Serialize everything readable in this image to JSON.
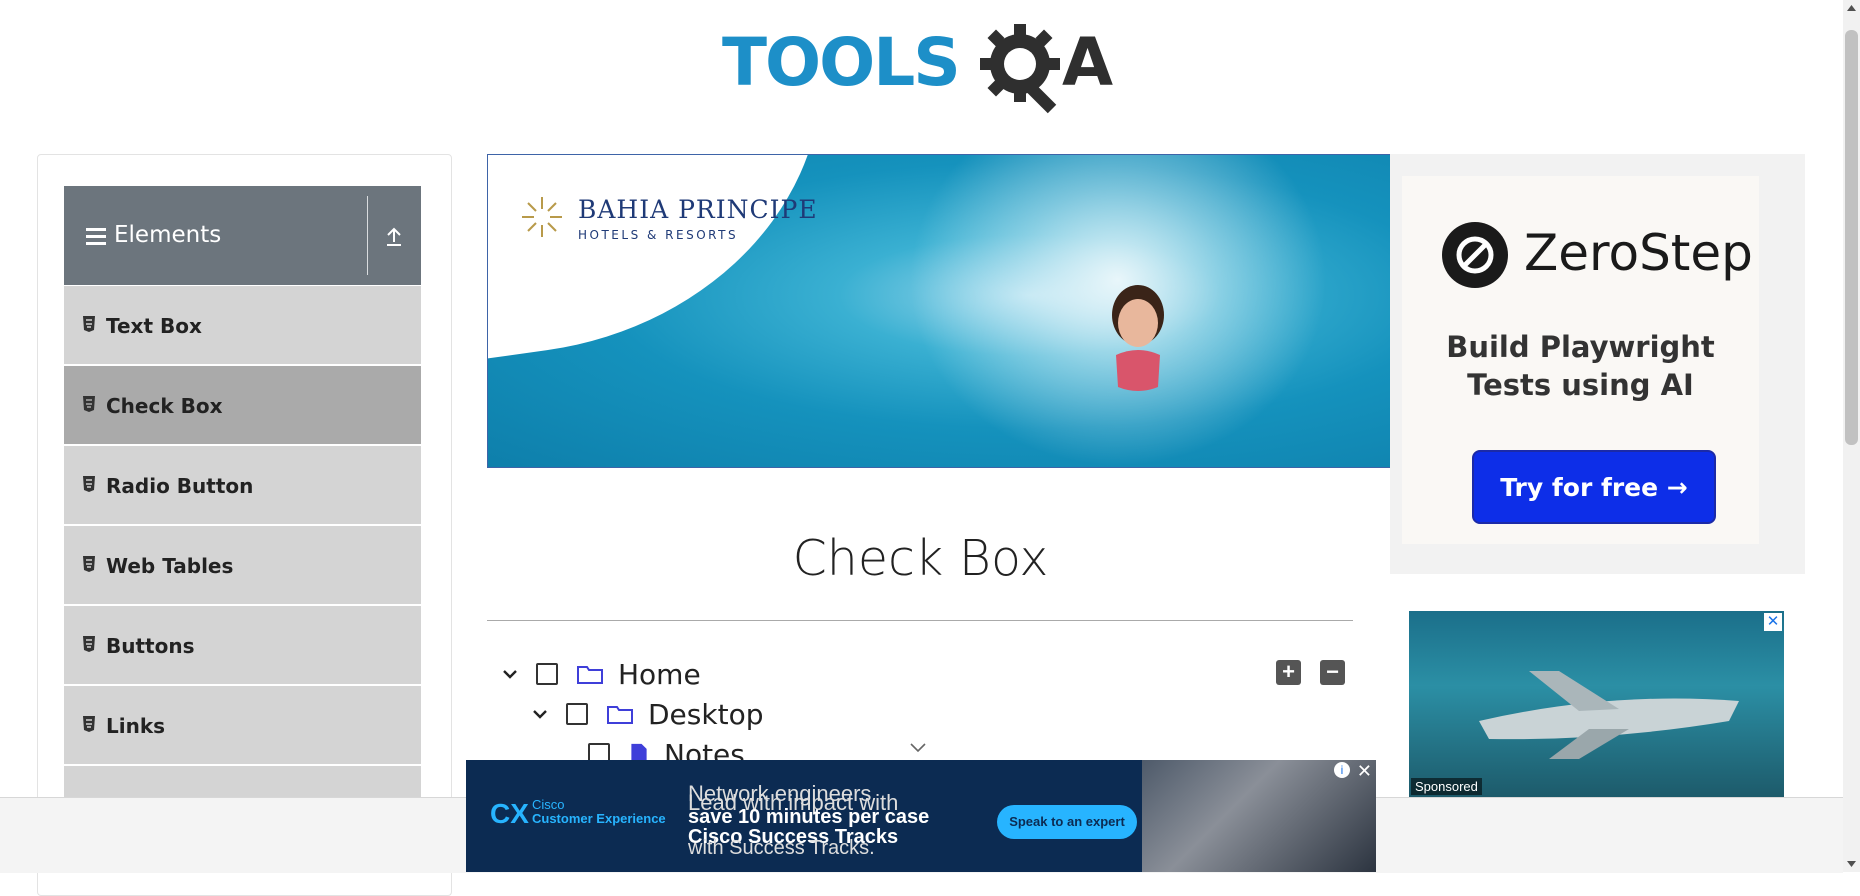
{
  "header": {
    "logo_tools": "TOOLS",
    "logo_a": "A"
  },
  "sidebar": {
    "group_title": "Elements",
    "items": [
      {
        "label": "Text Box",
        "active": false
      },
      {
        "label": "Check Box",
        "active": true
      },
      {
        "label": "Radio Button",
        "active": false
      },
      {
        "label": "Web Tables",
        "active": false
      },
      {
        "label": "Buttons",
        "active": false
      },
      {
        "label": "Links",
        "active": false
      }
    ]
  },
  "banner_ad": {
    "brand": "BAHIA PRINCIPE",
    "sub": "HOTELS & RESORTS"
  },
  "right_ad": {
    "brand": "ZeroStep",
    "tagline_line1": "Build Playwright",
    "tagline_line2": "Tests using AI",
    "cta": "Try for free →"
  },
  "ad2": {
    "sponsored": "Sponsored",
    "close": "✕"
  },
  "main": {
    "title": "Check Box",
    "expand_all": "+",
    "collapse_all": "−",
    "tree": [
      {
        "label": "Home",
        "level": 0,
        "type": "folder"
      },
      {
        "label": "Desktop",
        "level": 1,
        "type": "folder"
      },
      {
        "label": "Notes",
        "level": 2,
        "type": "file"
      }
    ]
  },
  "bottom_ad": {
    "cx_logo": "CX",
    "cx_line1": "Cisco",
    "cx_line2": "Customer Experience",
    "msg_a": "Network engineers",
    "msg_b": "Lead with impact with",
    "msg_c": "save 10 minutes per case",
    "msg_d": "Cisco Success Tracks",
    "msg_e": "with Success Tracks.",
    "cta": "Speak to an expert"
  },
  "colors": {
    "brand_blue": "#1d8fc8",
    "sidebar_header": "#6c757d",
    "zs_button": "#0d2ee8",
    "cisco_bg": "#0c2b52"
  }
}
